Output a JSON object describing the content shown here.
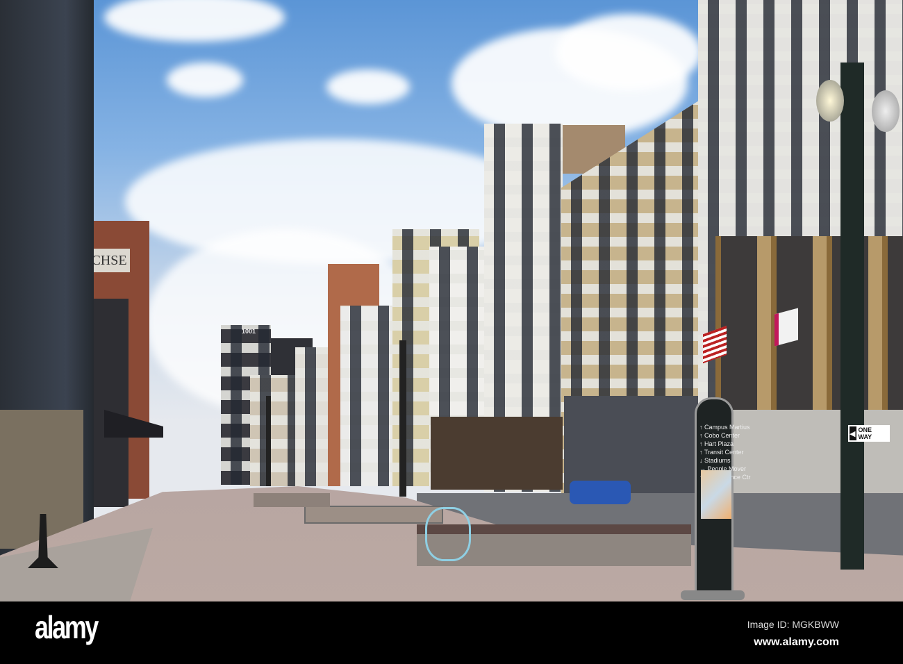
{
  "scene": {
    "building_signs": {
      "chse": "CHSE",
      "tower_number": "1001"
    },
    "one_way_sign": "ONE WAY",
    "wayfinding_sign": {
      "items": [
        "Campus Martius",
        "Cobo Center",
        "Hart Plaza",
        "Transit Center",
        "Stadiums",
        "People Mover",
        "Renaissance Ctr"
      ]
    }
  },
  "watermark": {
    "logo": "alamy",
    "image_id": "Image ID: MGKBWW",
    "url": "www.alamy.com"
  }
}
